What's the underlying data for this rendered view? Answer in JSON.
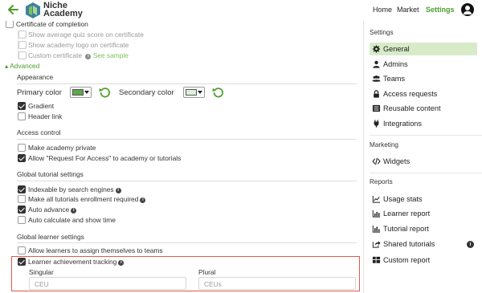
{
  "header": {
    "brand_line1": "Niche",
    "brand_line2": "Academy",
    "nav": [
      "Home",
      "Market",
      "Settings"
    ],
    "active_nav": "Settings"
  },
  "certificate": {
    "title": "Certificate of completion",
    "options": [
      {
        "label": "Show average quiz score on certificate",
        "checked": false
      },
      {
        "label": "Show academy logo on certificate",
        "checked": false
      },
      {
        "label": "Custom certificate",
        "checked": false
      }
    ],
    "see_sample": "See sample"
  },
  "advanced_toggle": "Advanced",
  "appearance": {
    "title": "Appearance",
    "primary_label": "Primary color",
    "secondary_label": "Secondary color",
    "primary_color": "#5fa84a",
    "secondary_color": "#dff0d8",
    "gradient": {
      "label": "Gradient",
      "checked": true
    },
    "header_link": {
      "label": "Header link",
      "checked": false
    }
  },
  "access": {
    "title": "Access control",
    "make_private": {
      "label": "Make academy private",
      "checked": false
    },
    "allow_request": {
      "label": "Allow \"Request For Access\" to academy or tutorials",
      "checked": true
    }
  },
  "tutorial": {
    "title": "Global tutorial settings",
    "indexable": {
      "label": "Indexable by search engines",
      "checked": true
    },
    "enrollment_required": {
      "label": "Make all tutorials enrollment required",
      "checked": false
    },
    "auto_advance": {
      "label": "Auto advance",
      "checked": true
    },
    "auto_calc": {
      "label": "Auto calculate and show time",
      "checked": false
    }
  },
  "learner": {
    "title": "Global learner settings",
    "assign_teams": {
      "label": "Allow learners to assign themselves to teams",
      "checked": false
    },
    "achievement": {
      "label": "Learner achievement tracking",
      "checked": true
    },
    "singular_label": "Singular",
    "plural_label": "Plural",
    "singular_placeholder": "CEU",
    "plural_placeholder": "CEUs"
  },
  "sidebar": {
    "settings_title": "Settings",
    "settings_items": [
      "General",
      "Admins",
      "Teams",
      "Access requests",
      "Reusable content",
      "Integrations"
    ],
    "marketing_title": "Marketing",
    "marketing_items": [
      "Widgets"
    ],
    "reports_title": "Reports",
    "reports_items": [
      "Usage stats",
      "Learner report",
      "Tutorial report",
      "Shared tutorials",
      "Custom report"
    ],
    "info_badge": "i"
  },
  "accent": "#4a9d2a",
  "highlight_color": "#e05a4a"
}
